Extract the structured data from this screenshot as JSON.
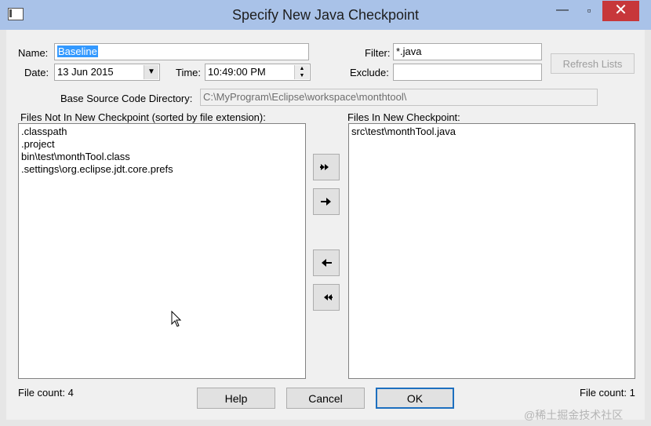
{
  "window": {
    "title": "Specify New Java Checkpoint"
  },
  "form": {
    "name_label": "Name:",
    "name_value": "Baseline",
    "date_label": "Date:",
    "date_value": "13  Jun  2015",
    "time_label": "Time:",
    "time_value": "10:49:00 PM",
    "filter_label": "Filter:",
    "filter_value": "*.java",
    "exclude_label": "Exclude:",
    "exclude_value": "",
    "refresh_label": "Refresh Lists",
    "base_dir_label": "Base Source Code Directory:",
    "base_dir_value": "C:\\MyProgram\\Eclipse\\workspace\\monthtool\\"
  },
  "left_list": {
    "label": "Files Not In New Checkpoint (sorted by file extension):",
    "items": [
      ".classpath",
      ".project",
      "bin\\test\\monthTool.class",
      ".settings\\org.eclipse.jdt.core.prefs"
    ],
    "count_label": "File count: 4"
  },
  "right_list": {
    "label": "Files In New Checkpoint:",
    "items": [
      "src\\test\\monthTool.java"
    ],
    "count_label": "File count: 1"
  },
  "buttons": {
    "help": "Help",
    "cancel": "Cancel",
    "ok": "OK"
  },
  "watermark": "@稀土掘金技术社区",
  "icons": [
    "app-icon",
    "minimize-icon",
    "maximize-icon",
    "close-icon",
    "move-all-right-icon",
    "move-right-icon",
    "move-left-icon",
    "move-all-left-icon",
    "mouse-cursor-icon"
  ]
}
